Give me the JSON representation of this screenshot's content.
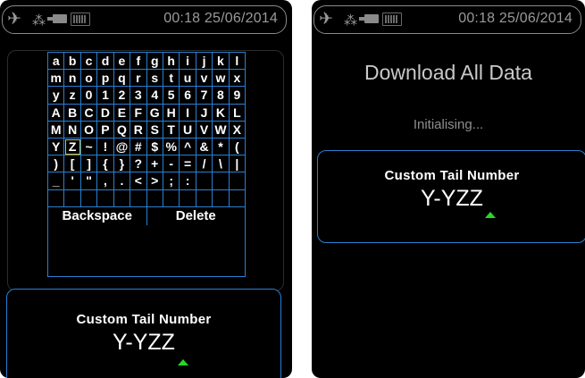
{
  "status_bar": {
    "time_date": "00:18 25/06/2014",
    "icons": [
      "airplane-icon",
      "network-icon",
      "plug-icon",
      "battery-icon"
    ]
  },
  "left_screen": {
    "title_behind": "Download All Data",
    "keyboard": {
      "rows": [
        [
          "a",
          "b",
          "c",
          "d",
          "e",
          "f",
          "g",
          "h",
          "i",
          "j",
          "k",
          "l"
        ],
        [
          "m",
          "n",
          "o",
          "p",
          "q",
          "r",
          "s",
          "t",
          "u",
          "v",
          "w",
          "x"
        ],
        [
          "y",
          "z",
          "0",
          "1",
          "2",
          "3",
          "4",
          "5",
          "6",
          "7",
          "8",
          "9"
        ],
        [
          "A",
          "B",
          "C",
          "D",
          "E",
          "F",
          "G",
          "H",
          "I",
          "J",
          "K",
          "L"
        ],
        [
          "M",
          "N",
          "O",
          "P",
          "Q",
          "R",
          "S",
          "T",
          "U",
          "V",
          "W",
          "X"
        ],
        [
          "Y",
          "Z",
          "~",
          "!",
          "@",
          "#",
          "$",
          "%",
          "^",
          "&",
          "*",
          "("
        ],
        [
          ")",
          "[",
          "]",
          "{",
          "}",
          "?",
          "+",
          "-",
          "=",
          "/",
          "\\",
          "|"
        ],
        [
          "_",
          "'",
          "\"",
          ",",
          ".",
          "<",
          ">",
          ";",
          ":",
          "",
          "",
          ""
        ],
        [
          "",
          "",
          "",
          "",
          "",
          "",
          "",
          "",
          "",
          "",
          "",
          ""
        ]
      ],
      "selected_key": "Z",
      "backspace_label": "Backspace",
      "delete_label": "Delete"
    },
    "tail_label": "Custom Tail Number",
    "tail_value": "Y-YZZ"
  },
  "right_screen": {
    "title": "Download All Data",
    "status": "Initialising...",
    "tail_label": "Custom Tail Number",
    "tail_value": "Y-YZZ"
  },
  "colors": {
    "accent_border": "#2a7fd0",
    "caret": "#25d925",
    "selection": "#e0c020"
  }
}
